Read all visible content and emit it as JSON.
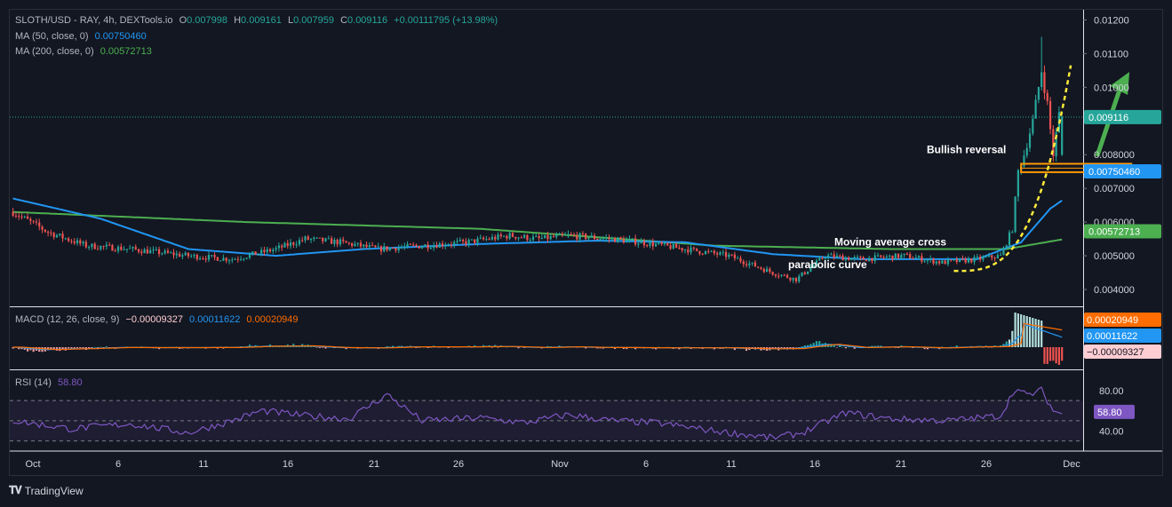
{
  "header": {
    "symbol": "SLOTH/USD - RAY, 4h, DEXTools.io",
    "o_label": "O",
    "o_value": "0.007998",
    "h_label": "H",
    "h_value": "0.009161",
    "l_label": "L",
    "l_value": "0.007959",
    "c_label": "C",
    "c_value": "0.009116",
    "change": "+0.00111795 (+13.98%)",
    "ma50_label": "MA (50, close, 0)",
    "ma50_value": "0.00750460",
    "ma200_label": "MA (200, close, 0)",
    "ma200_value": "0.00572713",
    "macd_label": "MACD (12, 26, close, 9)",
    "macd_hist": "−0.00009327",
    "macd_line": "0.00011622",
    "macd_signal": "0.00020949",
    "rsi_label": "RSI (14)",
    "rsi_value": "58.80"
  },
  "colors": {
    "up": "#26a69a",
    "down": "#ef5350",
    "ma50": "#2196f3",
    "ma200": "#4caf50",
    "macd_line": "#2196f3",
    "signal_line": "#ff6d00",
    "rsi": "#7e57c2",
    "annotation_yellow": "#ffeb3b",
    "support_orange": "#ff9800",
    "arrow_green": "#4caf50"
  },
  "price_axis": {
    "ticks": [
      "0.01200",
      "0.01100",
      "0.01000",
      "0.008000",
      "0.007000",
      "0.006000",
      "0.005000",
      "0.004000"
    ],
    "tick_values": [
      0.012,
      0.011,
      0.01,
      0.008,
      0.007,
      0.006,
      0.005,
      0.004
    ],
    "badges": [
      {
        "text": "0.009116",
        "value": 0.009116,
        "color": "#26a69a"
      },
      {
        "text": "0.00750460",
        "value": 0.0075046,
        "color": "#2196f3"
      },
      {
        "text": "0.00572713",
        "value": 0.00572713,
        "color": "#4caf50"
      }
    ]
  },
  "macd_axis": {
    "badges": [
      {
        "text": "0.00020949",
        "color": "#ff6d00",
        "text_color": "#ffffff"
      },
      {
        "text": "0.00011622",
        "color": "#2196f3",
        "text_color": "#ffffff"
      },
      {
        "text": "−0.00009327",
        "color": "#ffcdd2",
        "text_color": "#131722"
      }
    ]
  },
  "rsi_axis": {
    "ticks": [
      "80.00",
      "40.00"
    ],
    "tick_values": [
      80,
      40
    ],
    "badge": {
      "text": "58.80",
      "value": 58.8,
      "color": "#7e57c2"
    }
  },
  "time_axis": [
    "Oct",
    "6",
    "11",
    "16",
    "21",
    "26",
    "Nov",
    "6",
    "11",
    "16",
    "21",
    "26",
    "Dec"
  ],
  "annotations": {
    "bullish_reversal": "Bullish reversal",
    "moving_average_cross": "Moving average cross",
    "parabolic_curve": "parabolic curve"
  },
  "footer": {
    "brand": "TradingView"
  },
  "chart_data": [
    {
      "type": "candlestick",
      "title": "SLOTH/USD - RAY, 4h, DEXTools.io",
      "x_range": [
        "Oct 1",
        "Dec 1"
      ],
      "ylim": [
        0.0035,
        0.0123
      ],
      "bars": 360,
      "price_path": [
        [
          0,
          0.0063
        ],
        [
          12,
          0.0057
        ],
        [
          25,
          0.0053
        ],
        [
          40,
          0.0052
        ],
        [
          60,
          0.005
        ],
        [
          75,
          0.0049
        ],
        [
          90,
          0.0052
        ],
        [
          100,
          0.0055
        ],
        [
          112,
          0.0054
        ],
        [
          125,
          0.0052
        ],
        [
          140,
          0.0053
        ],
        [
          155,
          0.0054
        ],
        [
          170,
          0.0056
        ],
        [
          180,
          0.0055
        ],
        [
          190,
          0.0056
        ],
        [
          205,
          0.0055
        ],
        [
          215,
          0.0054
        ],
        [
          230,
          0.0052
        ],
        [
          245,
          0.005
        ],
        [
          260,
          0.0045
        ],
        [
          268,
          0.0043
        ],
        [
          278,
          0.005
        ],
        [
          290,
          0.0049
        ],
        [
          305,
          0.005
        ],
        [
          318,
          0.0048
        ],
        [
          330,
          0.0049
        ],
        [
          338,
          0.005
        ],
        [
          342,
          0.0058
        ],
        [
          344,
          0.0075
        ],
        [
          346,
          0.008
        ],
        [
          349,
          0.009
        ],
        [
          352,
          0.0105
        ],
        [
          354,
          0.0095
        ],
        [
          356,
          0.008
        ],
        [
          358,
          0.0092
        ],
        [
          360,
          0.008
        ],
        [
          363,
          0.0095
        ],
        [
          366,
          0.0085
        ],
        [
          369,
          0.0076
        ],
        [
          372,
          0.008
        ],
        [
          374,
          0.0091
        ]
      ],
      "last_candle": {
        "open": 0.007998,
        "high": 0.009161,
        "low": 0.007959,
        "close": 0.009116
      },
      "series": [
        {
          "name": "MA (50, close, 0)",
          "last": 0.0075046,
          "path": [
            [
              0,
              0.0067
            ],
            [
              30,
              0.0061
            ],
            [
              60,
              0.0052
            ],
            [
              90,
              0.005
            ],
            [
              120,
              0.0052
            ],
            [
              160,
              0.00535
            ],
            [
              200,
              0.00545
            ],
            [
              230,
              0.0054
            ],
            [
              260,
              0.00505
            ],
            [
              290,
              0.0049
            ],
            [
              330,
              0.0049
            ],
            [
              345,
              0.0054
            ],
            [
              355,
              0.0064
            ],
            [
              365,
              0.007
            ],
            [
              374,
              0.0075
            ]
          ]
        },
        {
          "name": "MA (200, close, 0)",
          "last": 0.00572713,
          "path": [
            [
              0,
              0.0063
            ],
            [
              80,
              0.006
            ],
            [
              160,
              0.0058
            ],
            [
              240,
              0.0053
            ],
            [
              300,
              0.0052
            ],
            [
              340,
              0.0052
            ],
            [
              360,
              0.0055
            ],
            [
              374,
              0.00573
            ]
          ]
        }
      ]
    },
    {
      "type": "line",
      "title": "MACD (12, 26, close, 9)",
      "series": [
        {
          "name": "MACD",
          "last": 0.00011622
        },
        {
          "name": "Signal",
          "last": 0.00020949
        },
        {
          "name": "Histogram",
          "last": -9.327e-05
        }
      ]
    },
    {
      "type": "line",
      "title": "RSI (14)",
      "ylim": [
        20,
        100
      ],
      "bands": [
        70,
        50,
        30
      ],
      "series": [
        {
          "name": "RSI (14)",
          "last": 58.8,
          "path": [
            [
              0,
              50
            ],
            [
              20,
              42
            ],
            [
              40,
              47
            ],
            [
              60,
              38
            ],
            [
              75,
              50
            ],
            [
              85,
              60
            ],
            [
              100,
              55
            ],
            [
              115,
              52
            ],
            [
              128,
              76
            ],
            [
              140,
              50
            ],
            [
              160,
              53
            ],
            [
              175,
              48
            ],
            [
              190,
              56
            ],
            [
              205,
              50
            ],
            [
              220,
              48
            ],
            [
              240,
              40
            ],
            [
              260,
              33
            ],
            [
              270,
              38
            ],
            [
              285,
              58
            ],
            [
              300,
              52
            ],
            [
              320,
              50
            ],
            [
              338,
              55
            ],
            [
              343,
              82
            ],
            [
              347,
              75
            ],
            [
              352,
              80
            ],
            [
              356,
              60
            ],
            [
              360,
              56
            ],
            [
              366,
              55
            ],
            [
              370,
              50
            ],
            [
              374,
              58.8
            ]
          ]
        }
      ]
    }
  ]
}
